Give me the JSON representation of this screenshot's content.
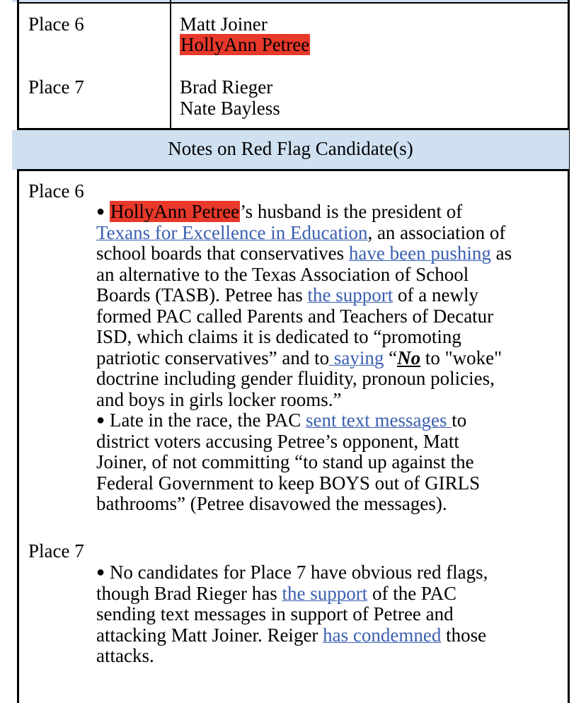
{
  "table": {
    "rows": [
      {
        "place": "Place 6",
        "candidates": [
          "Matt Joiner",
          "HollyAnn Petree"
        ],
        "flagged": "HollyAnn Petree"
      },
      {
        "place": "Place 7",
        "candidates": [
          "Brad Rieger",
          "Nate Bayless"
        ],
        "flagged": null
      }
    ],
    "highlight_color": "#e8392b",
    "header_bg_color": "#cfe0f1",
    "link_color": "#3a5fb0"
  },
  "notes": {
    "title": "Notes on Red Flag Candidate(s)",
    "place6": {
      "label": "Place 6",
      "bullet": "●",
      "b1_l1_name": "HollyAnn Petree",
      "b1_l1_rest": "’s husband is the president of",
      "b1_l2_link": "Texans for Excellence in Education",
      "b1_l2_rest": ", an association of",
      "b1_l3_pre": "school boards that conservatives ",
      "b1_l3_link": "have been pushing",
      "b1_l3_post": " as",
      "b1_l4": "an alternative to the Texas Association of School",
      "b1_l5_pre": "Boards (TASB). Petree has ",
      "b1_l5_link": "the support",
      "b1_l5_post": " of a newly",
      "b1_l6": "formed PAC called Parents and Teachers of Decatur",
      "b1_l7": "ISD, which claims it is dedicated to “promoting",
      "b1_l8_pre": "patriotic conservatives” and to",
      "b1_l8_link": " saying",
      "b1_l8_mid": " “",
      "b1_l8_em": "No",
      "b1_l8_post": " to \"woke\"",
      "b1_l9": "doctrine including gender fluidity, pronoun policies,",
      "b1_l10": "and boys in girls locker rooms.”",
      "b2_l1_pre": " Late in the race, the PAC ",
      "b2_l1_link": "sent text messages ",
      "b2_l1_post": "to",
      "b2_l2": "district voters accusing Petree’s opponent, Matt",
      "b2_l3": "Joiner, of not committing “to stand up against the",
      "b2_l4": "Federal Government to keep BOYS out of GIRLS",
      "b2_l5": "bathrooms” (Petree disavowed the messages)."
    },
    "place7": {
      "label": "Place 7",
      "bullet": "●",
      "l1": " No candidates for Place 7 have obvious red flags,",
      "l2_pre": "though Brad Rieger has ",
      "l2_link": "the support",
      "l2_post": " of the PAC",
      "l3": "sending text messages in support of Petree and",
      "l4_pre": "attacking Matt Joiner. Reiger ",
      "l4_link": "has condemned",
      "l4_post": " those",
      "l5": "attacks."
    }
  }
}
